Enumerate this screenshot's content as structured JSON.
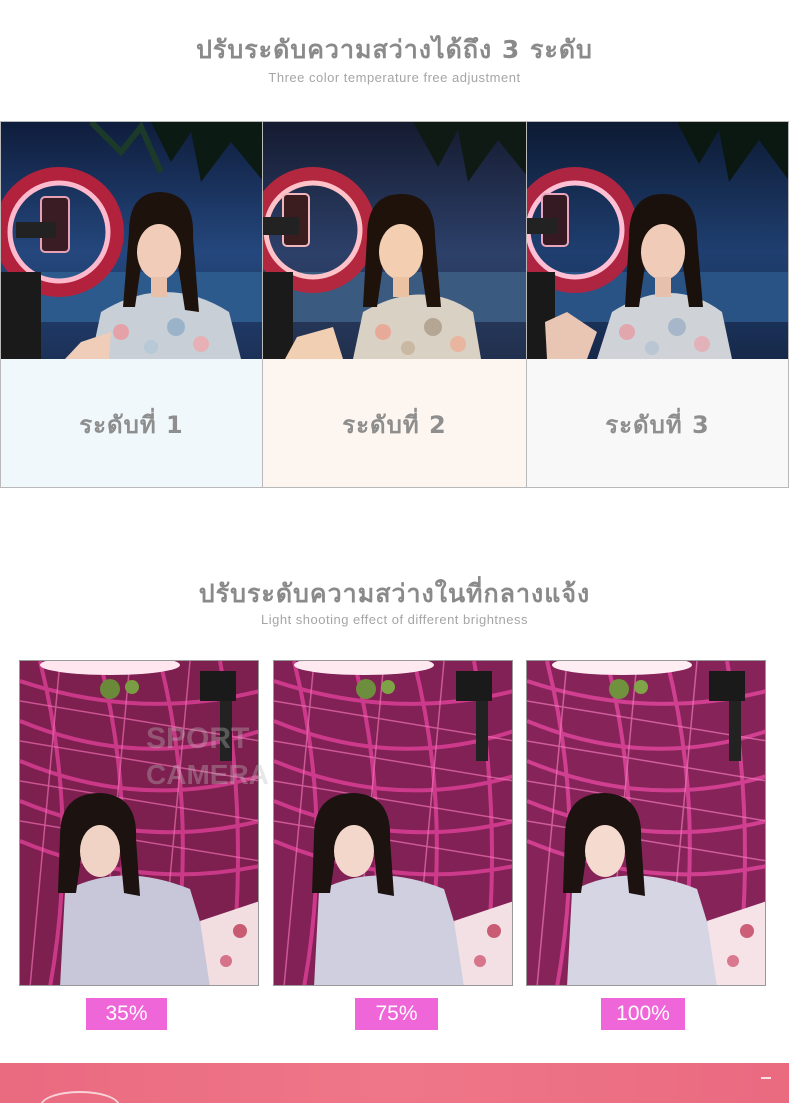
{
  "section1": {
    "title": "ปรับระดับความสว่างได้ถึง 3 ระดับ",
    "subtitle": "Three color temperature free adjustment",
    "panels": [
      {
        "label": "ระดับที่ 1",
        "bg": "#f1f8fc"
      },
      {
        "label": "ระดับที่ 2",
        "bg": "#fdf6f0"
      },
      {
        "label": "ระดับที่ 3",
        "bg": "#f8f8f8"
      }
    ]
  },
  "section2": {
    "title": "ปรับระดับความสว่างในที่กลางแจ้ง",
    "subtitle": "Light shooting effect of different brightness",
    "levels": [
      {
        "percent": "35%"
      },
      {
        "percent": "75%"
      },
      {
        "percent": "100%"
      }
    ],
    "badge_color": "#ee66d8"
  },
  "watermark": {
    "line1": "SPORT",
    "line2": "CAMERA"
  },
  "colors": {
    "heading": "#8a8a8a",
    "subheading": "#a5a5a5",
    "band": "#ea6a80"
  }
}
